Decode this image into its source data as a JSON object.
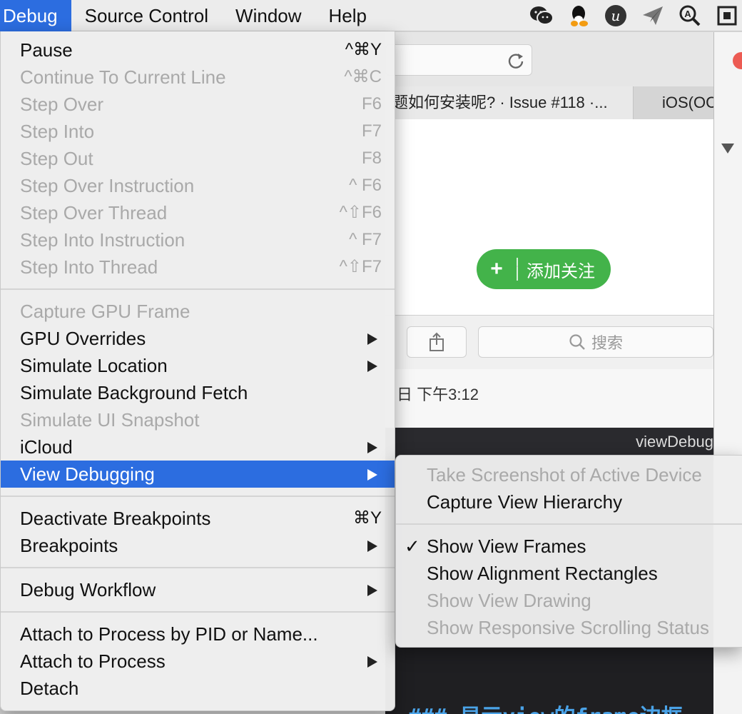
{
  "menubar": {
    "items": [
      "Debug",
      "Source Control",
      "Window",
      "Help"
    ],
    "active_index": 0,
    "tray_icons": [
      "wechat-icon",
      "qq-icon",
      "u-icon",
      "paper-plane-icon",
      "magnifier-a-icon",
      "window-icon"
    ]
  },
  "background": {
    "tabs": [
      "题如何安装呢? · Issue #118 ·...",
      "iOS(OC"
    ],
    "follow_button": {
      "plus": "+",
      "label": "添加关注"
    },
    "search_placeholder": "搜索",
    "date_text": "日 下午3:12",
    "code_header": "viewDebug",
    "code_line": "### 显示view的frame边框"
  },
  "debug_menu": {
    "items": [
      {
        "label": "Pause",
        "shortcut": "^⌘Y",
        "disabled": false
      },
      {
        "label": "Continue To Current Line",
        "shortcut": "^⌘C",
        "disabled": true
      },
      {
        "label": "Step Over",
        "shortcut": "F6",
        "disabled": true
      },
      {
        "label": "Step Into",
        "shortcut": "F7",
        "disabled": true
      },
      {
        "label": "Step Out",
        "shortcut": "F8",
        "disabled": true
      },
      {
        "label": "Step Over Instruction",
        "shortcut": "^ F6",
        "disabled": true
      },
      {
        "label": "Step Over Thread",
        "shortcut": "^⇧F6",
        "disabled": true
      },
      {
        "label": "Step Into Instruction",
        "shortcut": "^ F7",
        "disabled": true
      },
      {
        "label": "Step Into Thread",
        "shortcut": "^⇧F7",
        "disabled": true
      },
      {
        "separator": true
      },
      {
        "label": "Capture GPU Frame",
        "disabled": true
      },
      {
        "label": "GPU Overrides",
        "submenu": true
      },
      {
        "label": "Simulate Location",
        "submenu": true
      },
      {
        "label": "Simulate Background Fetch"
      },
      {
        "label": "Simulate UI Snapshot",
        "disabled": true
      },
      {
        "label": "iCloud",
        "submenu": true
      },
      {
        "label": "View Debugging",
        "submenu": true,
        "highlighted": true
      },
      {
        "separator": true
      },
      {
        "label": "Deactivate Breakpoints",
        "shortcut": "⌘Y"
      },
      {
        "label": "Breakpoints",
        "submenu": true
      },
      {
        "separator": true
      },
      {
        "label": "Debug Workflow",
        "submenu": true
      },
      {
        "separator": true
      },
      {
        "label": "Attach to Process by PID or Name..."
      },
      {
        "label": "Attach to Process",
        "submenu": true
      },
      {
        "label": "Detach"
      }
    ]
  },
  "view_debugging_submenu": {
    "items": [
      {
        "label": "Take Screenshot of Active Device",
        "disabled": true
      },
      {
        "label": "Capture View Hierarchy"
      },
      {
        "separator": true
      },
      {
        "label": "Show View Frames",
        "checked": true
      },
      {
        "label": "Show Alignment Rectangles"
      },
      {
        "label": "Show View Drawing",
        "disabled": true
      },
      {
        "label": "Show Responsive Scrolling Status",
        "disabled": true
      }
    ],
    "check_glyph": "✓"
  },
  "colors": {
    "highlight": "#2c6de0",
    "follow_green": "#43b34a",
    "disabled_text": "#a9a9a9"
  }
}
